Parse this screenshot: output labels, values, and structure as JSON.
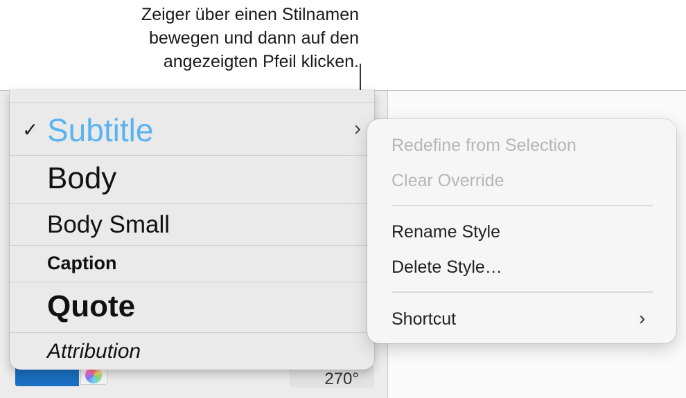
{
  "callout": {
    "lines": [
      "Zeiger über einen Stilnamen",
      "bewegen und dann auf den",
      "angezeigten Pfeil klicken."
    ]
  },
  "style_list": {
    "items": [
      {
        "label": "Subtitle",
        "selected": true,
        "color": "#5ab4f0"
      },
      {
        "label": "Body"
      },
      {
        "label": "Body Small"
      },
      {
        "label": "Caption"
      },
      {
        "label": "Quote"
      },
      {
        "label": "Attribution"
      }
    ],
    "check_glyph": "✓",
    "arrow_glyph": "›"
  },
  "context_menu": {
    "items": [
      {
        "label": "Redefine from Selection",
        "enabled": false
      },
      {
        "label": "Clear Override",
        "enabled": false
      },
      {
        "label": "Rename Style",
        "enabled": true
      },
      {
        "label": "Delete Style…",
        "enabled": true
      },
      {
        "label": "Shortcut",
        "enabled": true,
        "submenu": true
      }
    ],
    "submenu_glyph": "›"
  },
  "background": {
    "angle_value": "270°",
    "color_swatch": "#1a6fc2"
  }
}
